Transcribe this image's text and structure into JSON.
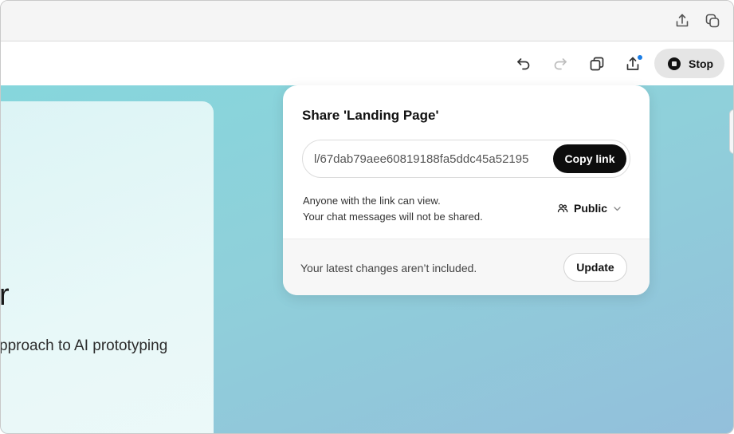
{
  "browser": {
    "share_icon": "share-icon",
    "tabs_icon": "tab-overview-icon"
  },
  "toolbar": {
    "undo_icon": "undo-icon",
    "redo_icon": "redo-icon",
    "duplicate_icon": "copy-icon",
    "share_icon": "share-upload-icon",
    "stop_label": "Stop"
  },
  "preview": {
    "heading_fragment": "r",
    "subtitle_fragment": "pproach to AI prototyping"
  },
  "share_popover": {
    "title": "Share 'Landing Page'",
    "link_value": "l/67dab79aee60819188fa5ddc45a52195",
    "copy_label": "Copy link",
    "info_line1": "Anyone with the link can view.",
    "info_line2": "Your chat messages will not be shared.",
    "visibility_label": "Public",
    "footer_text": "Your latest changes aren’t included.",
    "update_label": "Update"
  },
  "colors": {
    "accent_dot": "#1a7de5",
    "button_dark": "#0d0d0d",
    "canvas_teal": "#86d6dc"
  }
}
